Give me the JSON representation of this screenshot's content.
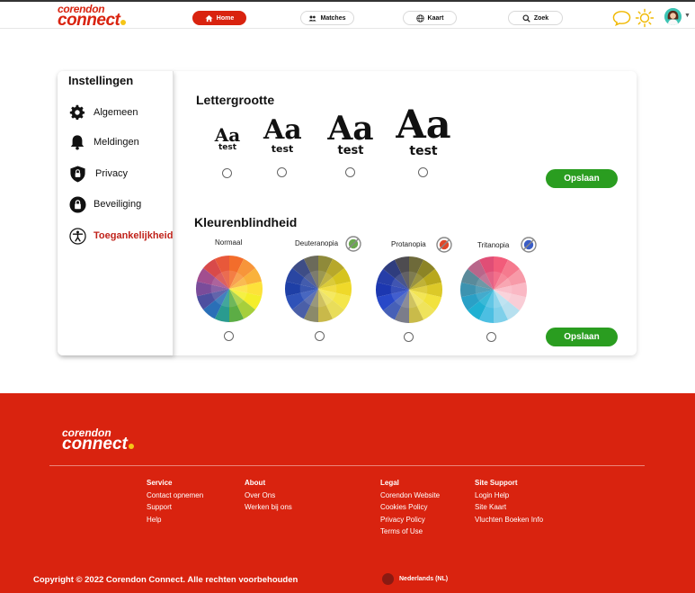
{
  "header": {
    "logo_top": "corendon",
    "logo_bottom": "connect",
    "nav": [
      {
        "label": "Home",
        "icon": "home-icon",
        "active": true
      },
      {
        "label": "Matches",
        "icon": "people-icon",
        "active": false
      },
      {
        "label": "Kaart",
        "icon": "globe-icon",
        "active": false
      },
      {
        "label": "Zoek",
        "icon": "search-icon",
        "active": false
      }
    ]
  },
  "sidebar": {
    "title": "Instellingen",
    "items": [
      {
        "label": "Algemeen",
        "icon": "gear-icon"
      },
      {
        "label": "Meldingen",
        "icon": "bell-icon"
      },
      {
        "label": "Privacy",
        "icon": "shield-icon"
      },
      {
        "label": "Beveiliging",
        "icon": "lock-icon"
      },
      {
        "label": "Toegankelijkheid",
        "icon": "accessibility-icon",
        "active": true
      }
    ]
  },
  "font_size": {
    "title": "Lettergrootte",
    "options": [
      {
        "glyph": "Aa",
        "word": "test"
      },
      {
        "glyph": "Aa",
        "word": "test"
      },
      {
        "glyph": "Aa",
        "word": "test"
      },
      {
        "glyph": "Aa",
        "word": "test"
      }
    ],
    "save_label": "Opslaan"
  },
  "color_blind": {
    "title": "Kleurenblindheid",
    "options": [
      {
        "label": "Normaal"
      },
      {
        "label": "Deuteranopia"
      },
      {
        "label": "Protanopia"
      },
      {
        "label": "Tritanopia"
      }
    ],
    "save_label": "Opslaan"
  },
  "footer": {
    "logo_top": "corendon",
    "logo_bottom": "connect",
    "columns": [
      {
        "heading": "Service",
        "links": [
          "Contact opnemen",
          "Support",
          "Help"
        ]
      },
      {
        "heading": "About",
        "links": [
          "Over Ons",
          "Werken bij ons"
        ]
      },
      {
        "heading": "Legal",
        "links": [
          "Corendon Website",
          "Cookies Policy",
          "Privacy Policy",
          "Terms of Use"
        ]
      },
      {
        "heading": "Site Support",
        "links": [
          "Login Help",
          "Site Kaart",
          "Vluchten Boeken Info"
        ]
      }
    ],
    "copyright": "Copyright © 2022 Corendon Connect. Alle rechten voorbehouden",
    "language": "Nederlands (NL)"
  },
  "colors": {
    "brand_red": "#d9230f",
    "save_green": "#2a9d20",
    "active_text": "#c0221a",
    "accent_yellow": "#f5c518"
  }
}
